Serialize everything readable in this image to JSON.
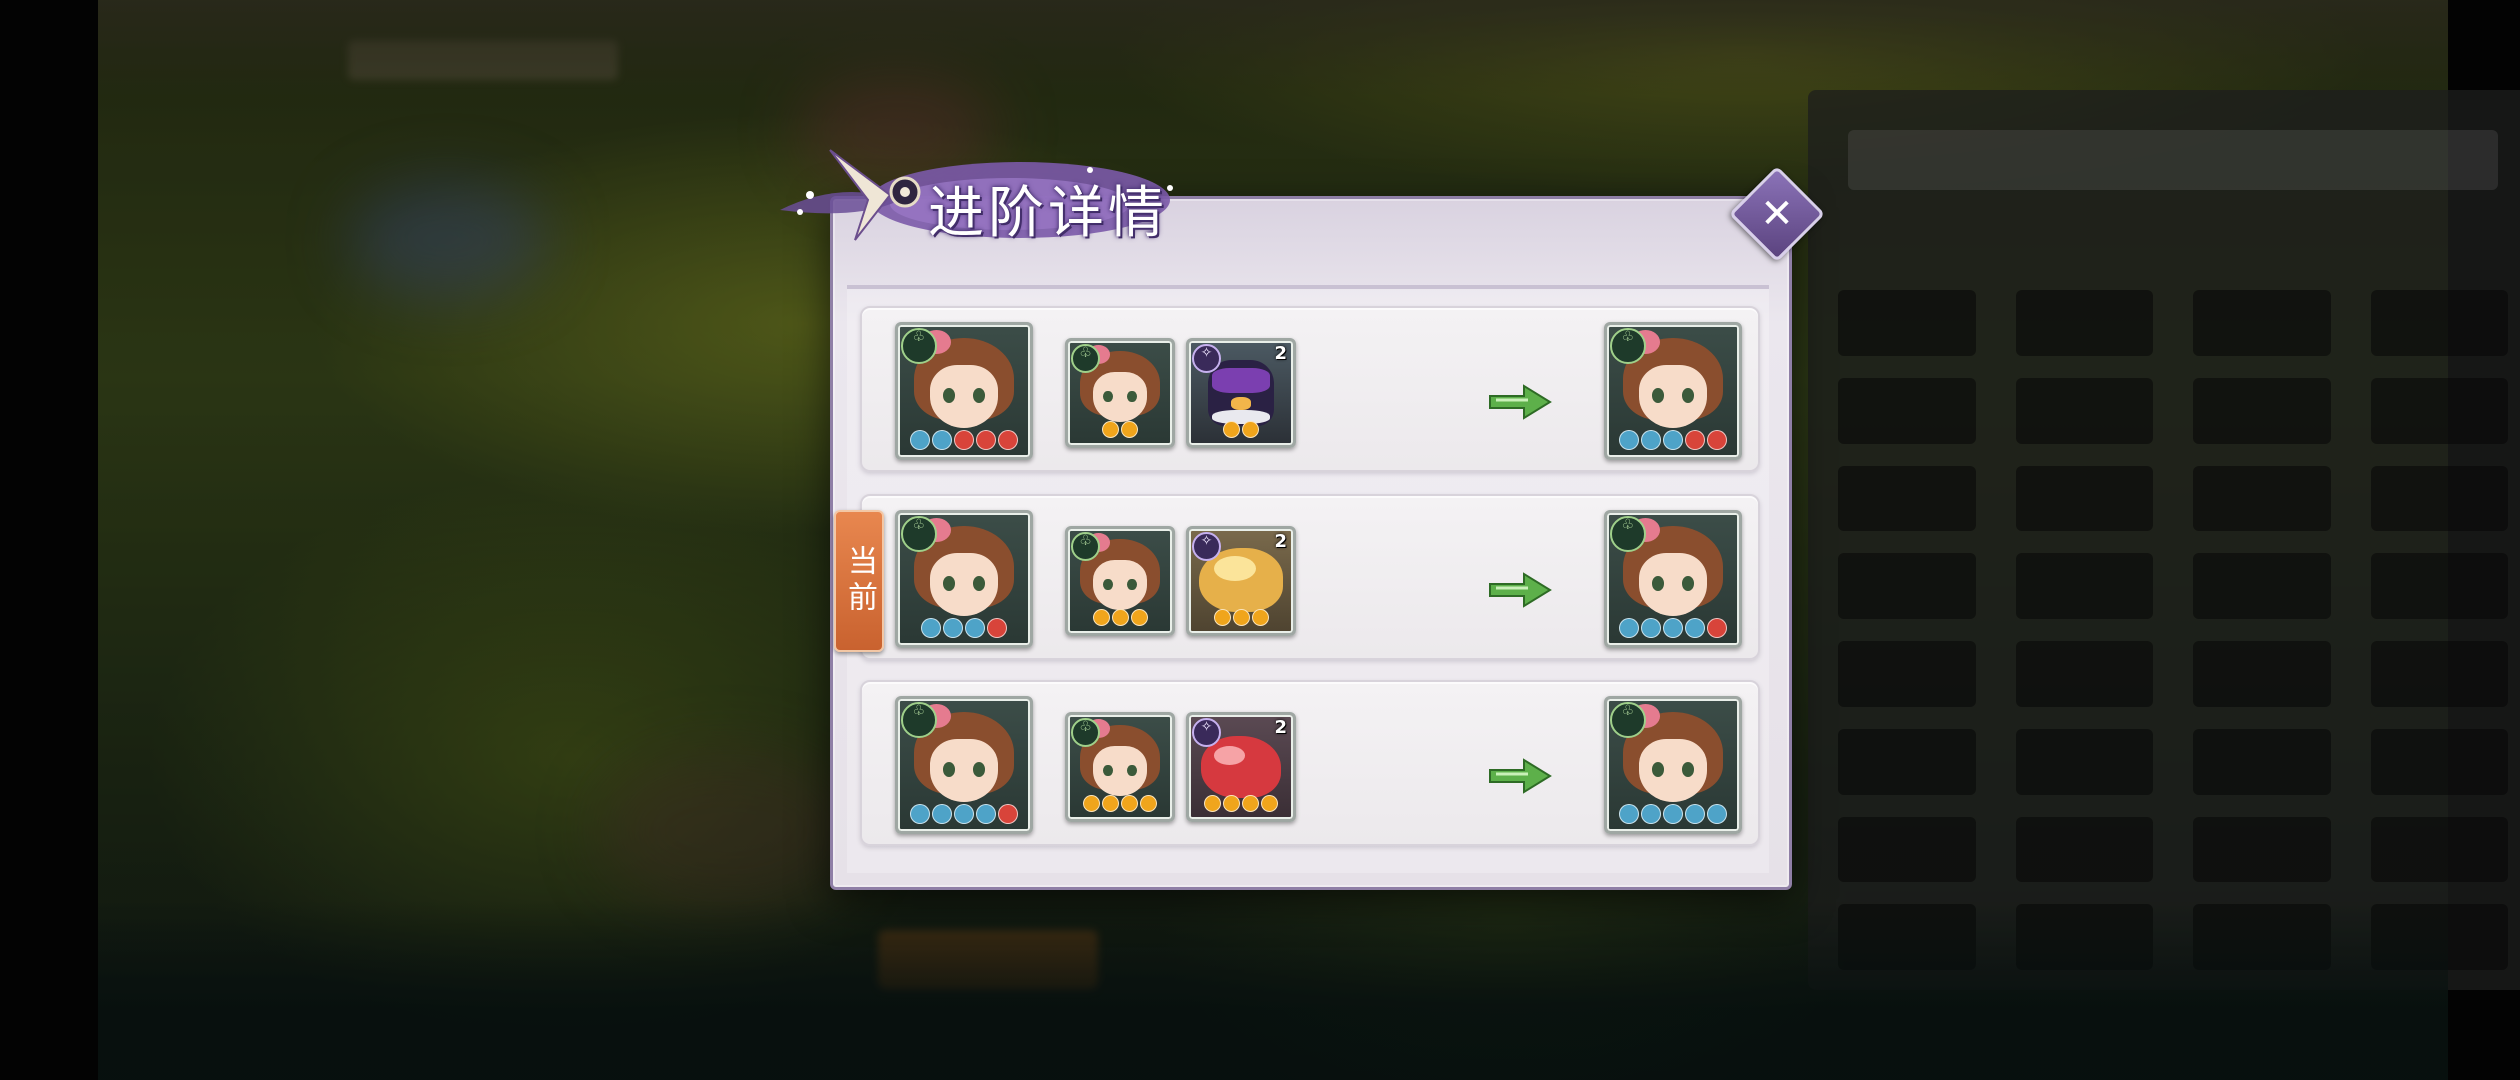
{
  "dialog": {
    "title": "进阶详情",
    "close_icon": "close-icon",
    "current_label": "当前"
  },
  "rows": [
    {
      "hero_before_stars": [
        "blue",
        "blue",
        "red",
        "red",
        "red"
      ],
      "material_hero_stars": [
        "gold",
        "gold"
      ],
      "material_pet": {
        "name_icon": "witch-bird-pet-icon",
        "count": "2",
        "stars": [
          "gold",
          "gold"
        ]
      },
      "hero_after_stars": [
        "blue",
        "blue",
        "blue",
        "red",
        "red"
      ]
    },
    {
      "hero_before_stars": [
        "blue",
        "blue",
        "blue",
        "red"
      ],
      "material_hero_stars": [
        "gold",
        "gold",
        "gold"
      ],
      "material_pet": {
        "name_icon": "golden-beast-pet-icon",
        "count": "2",
        "stars": [
          "gold",
          "gold",
          "gold"
        ]
      },
      "hero_after_stars": [
        "blue",
        "blue",
        "blue",
        "blue",
        "red"
      ]
    },
    {
      "hero_before_stars": [
        "blue",
        "blue",
        "blue",
        "blue",
        "red"
      ],
      "material_hero_stars": [
        "gold",
        "gold",
        "gold",
        "gold"
      ],
      "material_pet": {
        "name_icon": "red-beast-pet-icon",
        "count": "2",
        "stars": [
          "gold",
          "gold",
          "gold",
          "gold"
        ]
      },
      "hero_after_stars": [
        "blue",
        "blue",
        "blue",
        "blue",
        "blue"
      ]
    }
  ],
  "current_row_index": 1,
  "colors": {
    "accent": "#8f7fa6",
    "current_tag": "#d8713c",
    "arrow": "#5db04a"
  }
}
